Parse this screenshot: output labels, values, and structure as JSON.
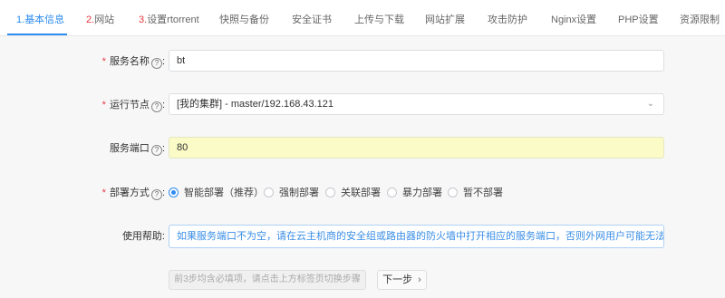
{
  "tabs": [
    {
      "num": "1.",
      "label": "基本信息"
    },
    {
      "num": "2.",
      "label": "网站"
    },
    {
      "num": "3.",
      "label": "设置rtorrent"
    },
    {
      "num": "",
      "label": "快照与备份"
    },
    {
      "num": "",
      "label": "安全证书"
    },
    {
      "num": "",
      "label": "上传与下载"
    },
    {
      "num": "",
      "label": "网站扩展"
    },
    {
      "num": "",
      "label": "攻击防护"
    },
    {
      "num": "",
      "label": "Nginx设置"
    },
    {
      "num": "",
      "label": "PHP设置"
    },
    {
      "num": "",
      "label": "资源限制"
    }
  ],
  "form": {
    "service_name": {
      "label": "服务名称",
      "value": "bt"
    },
    "run_node": {
      "label": "运行节点",
      "value": "[我的集群] - master/192.168.43.121"
    },
    "service_port": {
      "label": "服务端口",
      "value": "80"
    },
    "deploy_mode": {
      "label": "部署方式",
      "options": [
        "智能部署（推荐）",
        "强制部署",
        "关联部署",
        "暴力部署",
        "暂不部署"
      ],
      "selected": "智能部署（推荐）"
    },
    "usage_help": {
      "label": "使用帮助:",
      "text": "如果服务端口不为空，请在云主机商的安全组或路由器的防火墙中打开相应的服务端口，否则外网用户可能无法访问"
    }
  },
  "footer": {
    "disabled_hint": "前3步均含必填项，请点击上方标签页切换步骤",
    "next_label": "下一步"
  },
  "icons": {
    "help": "?",
    "chevron_down": "⌄",
    "chevron_right": "›"
  },
  "colors": {
    "accent": "#2d8cf0",
    "required": "#e6383e",
    "port_bg": "#fafbc6"
  }
}
